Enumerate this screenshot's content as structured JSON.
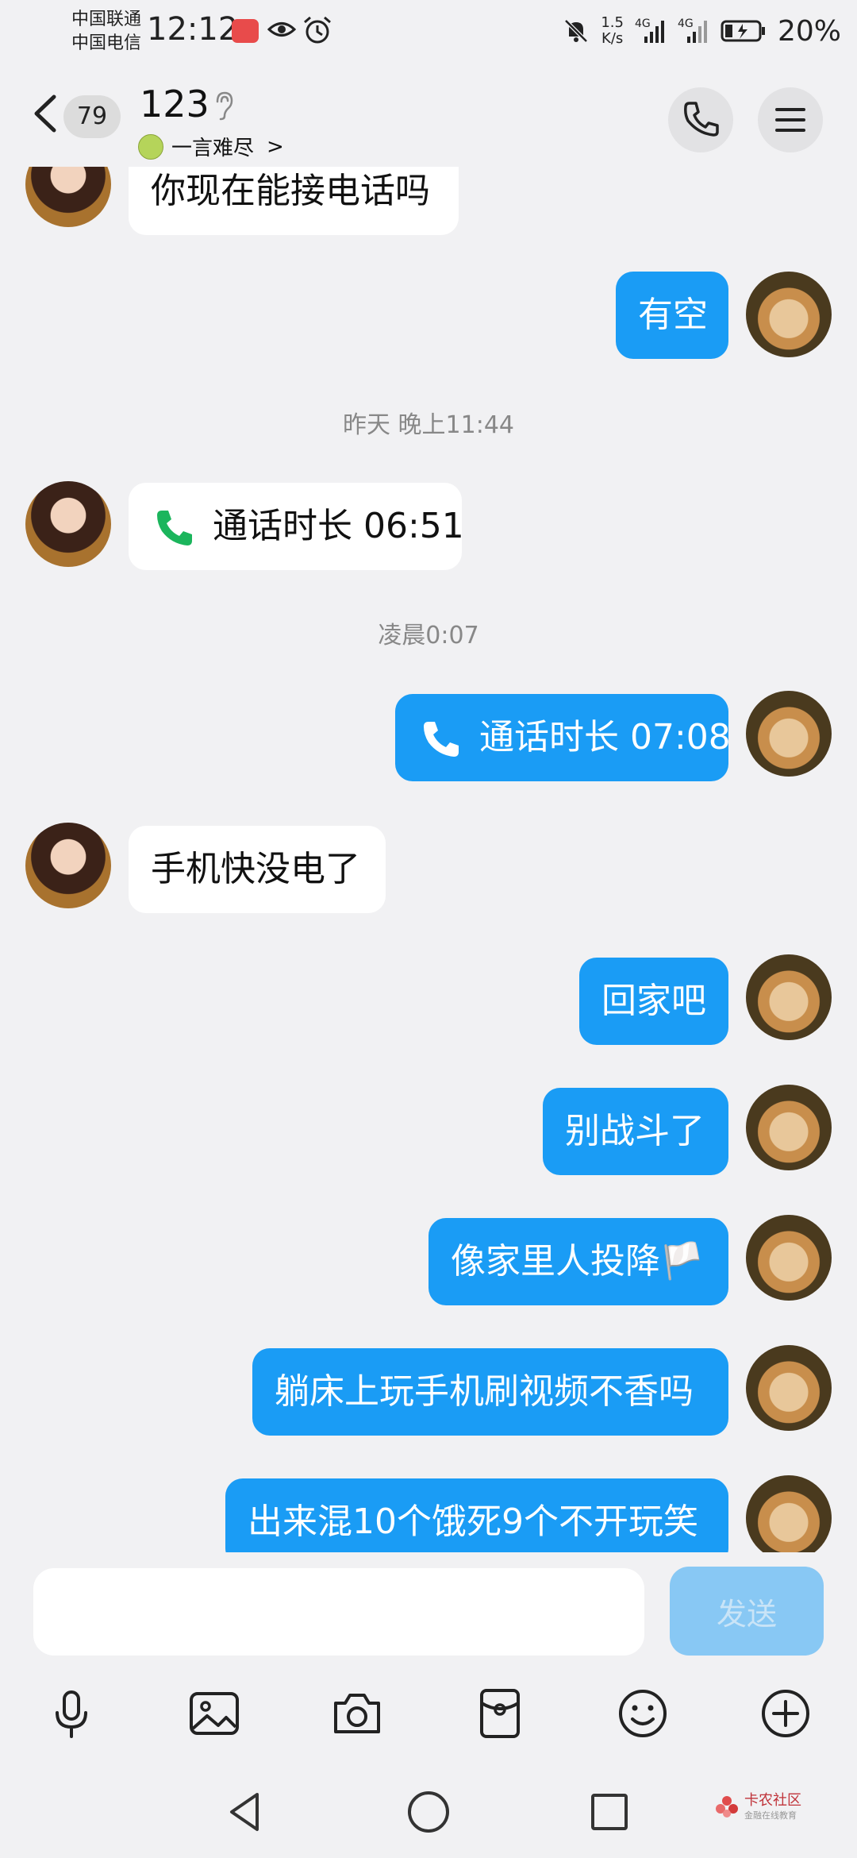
{
  "status_bar": {
    "carrier1": "中国联通",
    "carrier2": "中国电信",
    "time": "12:12",
    "net_speed_value": "1.5",
    "net_speed_unit": "K/s",
    "signal1": "4G",
    "signal2": "4G",
    "battery": "20%"
  },
  "header": {
    "unread_count": "79",
    "contact_name": "123",
    "mood_text": "一言难尽",
    "mood_chevron": ">"
  },
  "messages": [
    {
      "side": "in",
      "text": "你现在能接电话吗"
    },
    {
      "side": "out",
      "text": "有空"
    },
    {
      "type": "timestamp",
      "text": "昨天 晚上11:44"
    },
    {
      "side": "in",
      "type": "call",
      "text": "通话时长 06:51"
    },
    {
      "type": "timestamp",
      "text": "凌晨0:07"
    },
    {
      "side": "out",
      "type": "call",
      "text": "通话时长 07:08"
    },
    {
      "side": "in",
      "text": "手机快没电了"
    },
    {
      "side": "out",
      "text": "回家吧"
    },
    {
      "side": "out",
      "text": "别战斗了"
    },
    {
      "side": "out",
      "text": "像家里人投降🏳️"
    },
    {
      "side": "out",
      "text": "躺床上玩手机刷视频不香吗"
    },
    {
      "side": "out",
      "text": "出来混10个饿死9个不开玩笑"
    }
  ],
  "input": {
    "placeholder": "",
    "send_label": "发送"
  },
  "toolbar": {
    "items": [
      "microphone-icon",
      "image-icon",
      "camera-icon",
      "red-packet-icon",
      "emoji-icon",
      "plus-icon"
    ]
  },
  "watermark": {
    "title": "卡农社区",
    "subtitle": "金融在线教育"
  },
  "colors": {
    "background": "#f1f1f3",
    "outgoing_bubble": "#1a9cf5",
    "incoming_bubble": "#ffffff",
    "send_button": "#88c8f4",
    "call_icon_green": "#1bb55c"
  }
}
